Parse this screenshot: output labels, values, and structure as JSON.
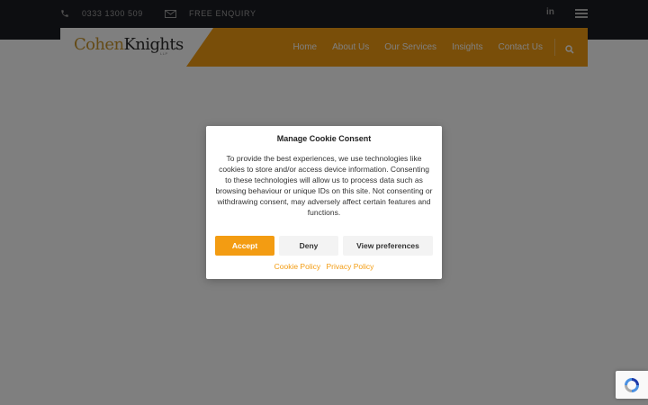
{
  "topbar": {
    "phone": "0333 1300 509",
    "enquiry": "FREE ENQUIRY",
    "linkedin": "in",
    "phone_icon": "phone-icon",
    "enquiry_icon": "envelope-icon",
    "menu_icon": "hamburger-menu-icon"
  },
  "header": {
    "logo_part1": "Cohen",
    "logo_part2": "Knights",
    "logo_suffix": "LLP",
    "nav": [
      "Home",
      "About Us",
      "Our Services",
      "Insights",
      "Contact Us"
    ],
    "search_icon": "search-icon"
  },
  "cookie_dialog": {
    "title": "Manage Cookie Consent",
    "body": "To provide the best experiences, we use technologies like cookies to store and/or access device information. Consenting to these technologies will allow us to process data such as browsing behaviour or unique IDs on this site. Not consenting or withdrawing consent, may adversely affect certain features and functions.",
    "accept": "Accept",
    "deny": "Deny",
    "preferences": "View preferences",
    "links": [
      "Cookie Policy",
      "Privacy Policy"
    ]
  },
  "colors": {
    "accent": "#f39c12",
    "topbar": "#1b1c22",
    "overlay": "rgba(0,0,0,0.5)"
  },
  "recaptcha_icon": "recaptcha-icon"
}
